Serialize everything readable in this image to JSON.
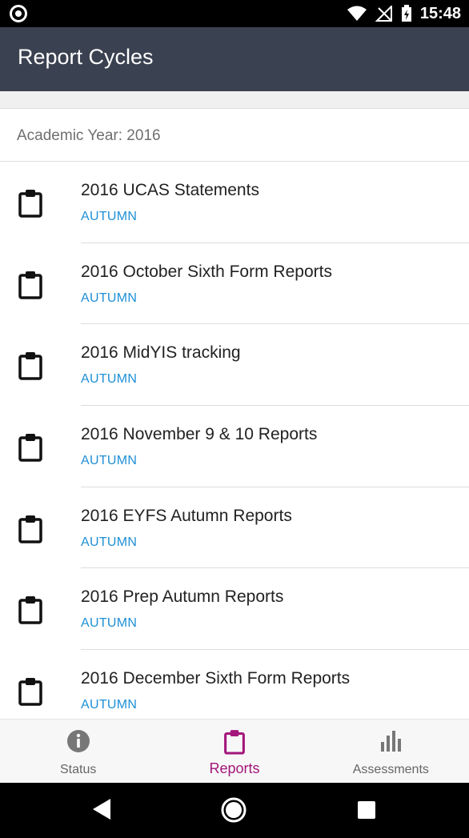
{
  "status_bar": {
    "time": "15:48"
  },
  "app_bar": {
    "title": "Report Cycles"
  },
  "section": {
    "academic_year_label": "Academic Year: 2016"
  },
  "reports": [
    {
      "name": "2016 UCAS Statements",
      "term": "AUTUMN"
    },
    {
      "name": "2016 October Sixth Form Reports",
      "term": "AUTUMN"
    },
    {
      "name": "2016 MidYIS tracking",
      "term": "AUTUMN"
    },
    {
      "name": "2016 November 9 & 10 Reports",
      "term": "AUTUMN"
    },
    {
      "name": "2016 EYFS Autumn Reports",
      "term": "AUTUMN"
    },
    {
      "name": "2016 Prep Autumn Reports",
      "term": "AUTUMN"
    },
    {
      "name": "2016 December Sixth Form Reports",
      "term": "AUTUMN"
    }
  ],
  "bottom_nav": {
    "items": [
      {
        "label": "Status",
        "icon": "info-icon",
        "active": false
      },
      {
        "label": "Reports",
        "icon": "clipboard-icon",
        "active": true
      },
      {
        "label": "Assessments",
        "icon": "bar-chart-icon",
        "active": false
      }
    ]
  },
  "colors": {
    "app_bar": "#3a4150",
    "term_text": "#1e8fd6",
    "active_nav": "#a3167b",
    "inactive_nav": "#666666"
  }
}
